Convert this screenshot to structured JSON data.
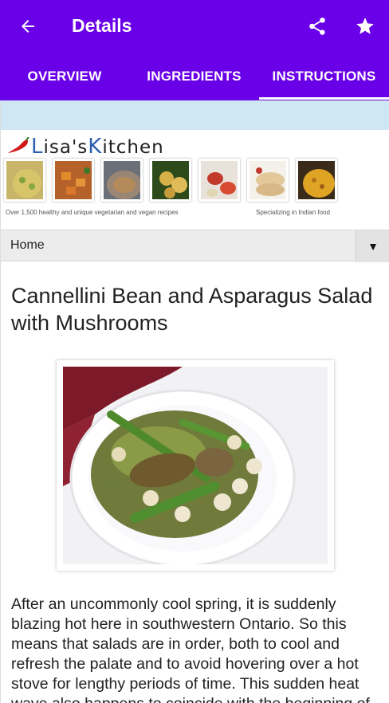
{
  "appbar": {
    "title": "Details",
    "back_icon": "arrow-back-icon",
    "share_icon": "share-icon",
    "favorite_icon": "star-icon",
    "color": "#6a00e8"
  },
  "tabs": [
    {
      "label": "OVERVIEW"
    },
    {
      "label": "INGREDIENTS"
    },
    {
      "label": "INSTRUCTIONS",
      "selected": true
    }
  ],
  "site": {
    "logo_text_prefix": "L",
    "logo_text_mid": "isa's",
    "logo_text_k": "K",
    "logo_text_suffix": "itchen",
    "tagline_left": "Over 1,500 healthy and unique vegetarian and vegan recipes",
    "tagline_right": "Specializing in Indian food"
  },
  "nav": {
    "selected": "Home"
  },
  "recipe": {
    "title": "Cannellini Bean and Asparagus Salad with Mushrooms",
    "intro": "After an uncommonly cool spring, it is suddenly blazing hot here in southwestern Ontario. So this means that salads are in order, both to cool and refresh the palate and to avoid hovering over a hot stove for lengthy periods of time. This sudden heat wave also happens to coincide with the beginning of"
  }
}
